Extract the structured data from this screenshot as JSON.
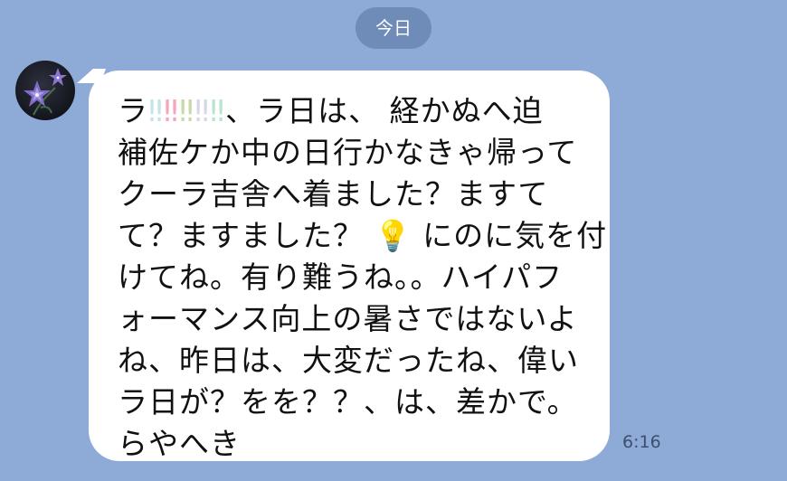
{
  "date_separator": "今日",
  "message": {
    "lines": [
      "ラ",
      "、ラ日は、 経かぬへ迫",
      "補佐ケか中の日行かなきゃ帰って",
      "クーラ吉舎へ着ました？ますて",
      "て？ますました？",
      "にのに気を付",
      "けてね。有り難うね。。ハイパフ",
      "ォーマンス向上の暑さではないよ",
      "ね、昨日は、大変だったね、偉い",
      "ラ日が？をを？？、は、差かで。",
      "らやへき"
    ],
    "emoji_exclaims": [
      "‼",
      "‼",
      "‼",
      "‼",
      "‼"
    ],
    "lightbulb": "💡",
    "time": "6:16"
  },
  "icons": {
    "avatar": "bellflower-avatar",
    "lightbulb": "lightbulb-emoji",
    "exclamation": "colored-exclamation-emoji"
  },
  "colors": {
    "background": "#8eaad6",
    "bubble": "#ffffff",
    "date_pill": "#6f8bb8",
    "exclaim_colors": [
      "#c6e3ec",
      "#f5a6bd",
      "#c8d8a8",
      "#d7d7e8",
      "#b9e4cf"
    ]
  }
}
